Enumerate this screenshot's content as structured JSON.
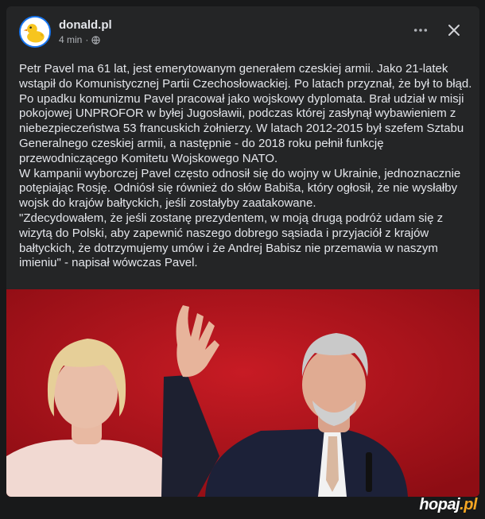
{
  "post": {
    "page_name": "donald.pl",
    "time": "4 min",
    "separator": "·",
    "paragraphs": [
      "Petr Pavel ma 61 lat, jest emerytowanym generałem czeskiej armii. Jako 21-latek wstąpił do Komunistycznej Partii Czechosłowackiej. Po latach przyznał, że był to błąd. Po upadku komunizmu Pavel pracował jako wojskowy dyplomata. Brał udział w misji pokojowej UNPROFOR w byłej Jugosławii, podczas której zasłynął wybawieniem z niebezpieczeństwa 53 francuskich żołnierzy. W latach 2012-2015 był szefem Sztabu Generalnego czeskiej armii, a następnie - do 2018 roku pełnił funkcję przewodniczącego Komitetu Wojskowego NATO.",
      "W kampanii wyborczej Pavel często odnosił się do wojny w Ukrainie, jednoznacznie potępiając Rosję. Odniósł się również do słów Babiša, który ogłosił, że nie wysłałby wojsk do krajów bałtyckich, jeśli zostałyby zaatakowane.",
      "\"Zdecydowałem, że jeśli zostanę prezydentem, w moją drugą podróż udam się z wizytą do Polski, aby zapewnić naszego dobrego sąsiada i przyjaciół z krajów bałtyckich, że dotrzymujemy umów i że Andrej Babisz nie przemawia w naszym imieniu\" - napisał wówczas Pavel."
    ]
  },
  "watermark": {
    "brand": "hopaj",
    "suffix": ".pl"
  },
  "icons": {
    "avatar": "duck-logo-icon",
    "privacy": "globe-icon",
    "more": "more-horizontal-icon",
    "close": "close-icon"
  },
  "colors": {
    "background": "#18191a",
    "card": "#242526",
    "text": "#e4e6eb",
    "secondary_text": "#b0b3b8",
    "photo_background": "#b0141c",
    "watermark_accent": "#f5a623"
  }
}
